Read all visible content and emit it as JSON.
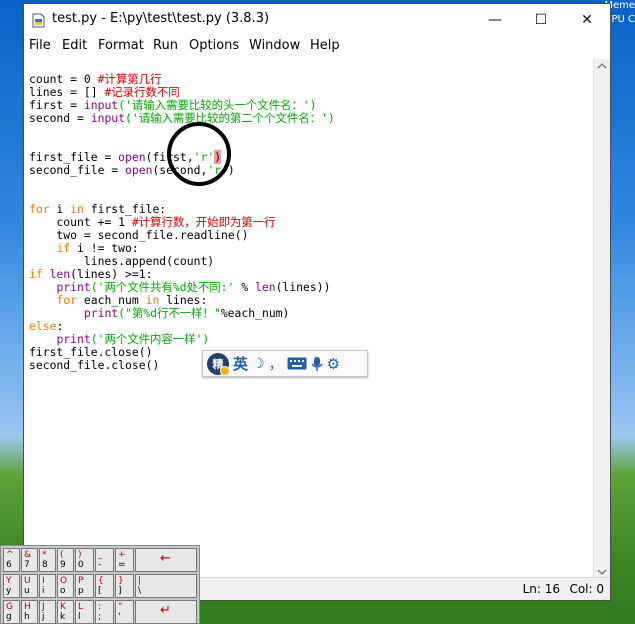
{
  "window": {
    "title": "test.py - E:\\py\\test\\test.py (3.8.3)",
    "minimize": "—",
    "maximize": "☐",
    "close": "✕"
  },
  "menu": [
    "File",
    "Edit",
    "Format",
    "Run",
    "Options",
    "Window",
    "Help"
  ],
  "code": [
    [
      {
        "t": "count = 0 ",
        "c": ""
      },
      {
        "t": "#计算第几行",
        "c": "cm"
      }
    ],
    [
      {
        "t": "lines = [] ",
        "c": ""
      },
      {
        "t": "#记录行数不同",
        "c": "cm"
      }
    ],
    [
      {
        "t": "first = ",
        "c": ""
      },
      {
        "t": "input",
        "c": "bi"
      },
      {
        "t": "('请输入需要比较的头一个文件名：')",
        "c": "str"
      }
    ],
    [
      {
        "t": "second = ",
        "c": ""
      },
      {
        "t": "input",
        "c": "bi"
      },
      {
        "t": "('请输入需要比较的第二个个文件名：')",
        "c": "str"
      }
    ],
    [],
    [],
    [
      {
        "t": "first_file = ",
        "c": ""
      },
      {
        "t": "open",
        "c": "bi"
      },
      {
        "t": "(first,",
        "c": ""
      },
      {
        "t": "'r'",
        "c": "str"
      },
      {
        "t": ")",
        "c": "hl"
      }
    ],
    [
      {
        "t": "second_file = ",
        "c": ""
      },
      {
        "t": "open",
        "c": "bi"
      },
      {
        "t": "(second,",
        "c": ""
      },
      {
        "t": "'r'",
        "c": "str"
      },
      {
        "t": ")",
        "c": ""
      }
    ],
    [],
    [],
    [
      {
        "t": "for",
        "c": "kw"
      },
      {
        "t": " i ",
        "c": ""
      },
      {
        "t": "in",
        "c": "kw"
      },
      {
        "t": " first_file:",
        "c": ""
      }
    ],
    [
      {
        "t": "    count += 1 ",
        "c": ""
      },
      {
        "t": "#计算行数，开始即为第一行",
        "c": "cm"
      }
    ],
    [
      {
        "t": "    two = second_file.readline()",
        "c": ""
      }
    ],
    [
      {
        "t": "    ",
        "c": ""
      },
      {
        "t": "if",
        "c": "kw"
      },
      {
        "t": " i != two:",
        "c": ""
      }
    ],
    [
      {
        "t": "        lines.append(count)",
        "c": ""
      }
    ],
    [
      {
        "t": "if",
        "c": "kw"
      },
      {
        "t": " ",
        "c": ""
      },
      {
        "t": "len",
        "c": "bi"
      },
      {
        "t": "(lines) >=1:",
        "c": ""
      }
    ],
    [
      {
        "t": "    ",
        "c": ""
      },
      {
        "t": "print",
        "c": "bi"
      },
      {
        "t": "('两个文件共有%d处不同:'",
        "c": "str"
      },
      {
        "t": " % ",
        "c": ""
      },
      {
        "t": "len",
        "c": "bi"
      },
      {
        "t": "(lines))",
        "c": ""
      }
    ],
    [
      {
        "t": "    ",
        "c": ""
      },
      {
        "t": "for",
        "c": "kw"
      },
      {
        "t": " each_num ",
        "c": ""
      },
      {
        "t": "in",
        "c": "kw"
      },
      {
        "t": " lines:",
        "c": ""
      }
    ],
    [
      {
        "t": "        ",
        "c": ""
      },
      {
        "t": "print",
        "c": "bi"
      },
      {
        "t": "(\"第%d行不一样！\"",
        "c": "str"
      },
      {
        "t": "%each_num)",
        "c": ""
      }
    ],
    [
      {
        "t": "else",
        "c": "kw"
      },
      {
        "t": ":",
        "c": ""
      }
    ],
    [
      {
        "t": "    ",
        "c": ""
      },
      {
        "t": "print",
        "c": "bi"
      },
      {
        "t": "('两个文件内容一样')",
        "c": "str"
      }
    ],
    [
      {
        "t": "first_file.close()",
        "c": ""
      }
    ],
    [
      {
        "t": "second_file.close()",
        "c": ""
      }
    ]
  ],
  "status": {
    "ln": "Ln: 16",
    "col": "Col: 0"
  },
  "ime": {
    "logo": "精",
    "lang": "英",
    "moon": "☽",
    "punct": "，",
    "mic": "🎤",
    "gear": "⚙"
  },
  "keyboard": [
    {
      "top": "^",
      "bot": "6"
    },
    {
      "top": "&",
      "bot": "7"
    },
    {
      "top": "*",
      "bot": "8"
    },
    {
      "top": "(",
      "bot": "9"
    },
    {
      "top": ")",
      "bot": "0"
    },
    {
      "top": "_",
      "bot": "-"
    },
    {
      "top": "+",
      "bot": "="
    },
    {
      "top": "",
      "bot": "←"
    },
    {
      "top": "Y",
      "bot": "y"
    },
    {
      "top": "U",
      "bot": "u"
    },
    {
      "top": "I",
      "bot": "i"
    },
    {
      "top": "O",
      "bot": "o"
    },
    {
      "top": "P",
      "bot": "p"
    },
    {
      "top": "{",
      "bot": "["
    },
    {
      "top": "}",
      "bot": "]"
    },
    {
      "top": "|",
      "bot": "\\"
    },
    {
      "top": "G",
      "bot": "g"
    },
    {
      "top": "H",
      "bot": "h"
    },
    {
      "top": "J",
      "bot": "j"
    },
    {
      "top": "K",
      "bot": "k"
    },
    {
      "top": "L",
      "bot": "l"
    },
    {
      "top": ":",
      "bot": ";"
    },
    {
      "top": "\"",
      "bot": "'"
    },
    {
      "top": "",
      "bot": "↵"
    }
  ],
  "desktop": {
    "label1": "Meme",
    "label2": "PU C"
  }
}
